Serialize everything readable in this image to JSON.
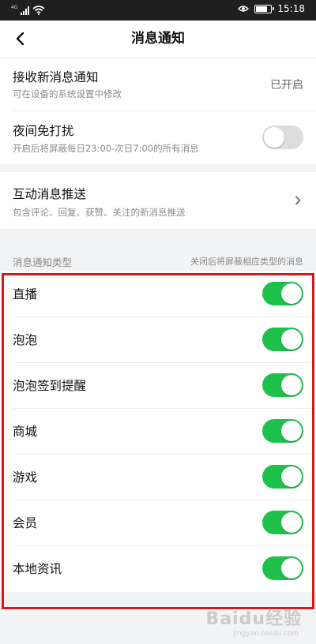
{
  "status_bar": {
    "network_label": "4G",
    "time": "15:18",
    "battery_level": 0.85
  },
  "nav": {
    "title": "消息通知",
    "back_icon": "chevron-left-icon"
  },
  "settings": {
    "receive": {
      "title": "接收新消息通知",
      "subtitle": "可在设备的系统设置中修改",
      "status": "已开启"
    },
    "dnd": {
      "title": "夜间免打扰",
      "subtitle": "开启后将屏蔽每日23:00-次日7:00的所有消息",
      "enabled": false
    },
    "interactive": {
      "title": "互动消息推送",
      "subtitle": "包含评论、回复、获赞、关注的新消息推送",
      "icon": "chevron-right-icon"
    }
  },
  "types_header": {
    "label": "消息通知类型",
    "hint": "关闭后将屏蔽相应类型的消息"
  },
  "types": [
    {
      "label": "直播",
      "enabled": true
    },
    {
      "label": "泡泡",
      "enabled": true
    },
    {
      "label": "泡泡签到提醒",
      "enabled": true
    },
    {
      "label": "商城",
      "enabled": true
    },
    {
      "label": "游戏",
      "enabled": true
    },
    {
      "label": "会员",
      "enabled": true
    },
    {
      "label": "本地资讯",
      "enabled": true
    }
  ],
  "colors": {
    "toggle_on": "#1ec24b",
    "toggle_off": "#dcdcdc",
    "highlight": "#d41b1b"
  },
  "watermark": {
    "text": "Baidu经验",
    "sub": "jingyan.baidu.com"
  }
}
